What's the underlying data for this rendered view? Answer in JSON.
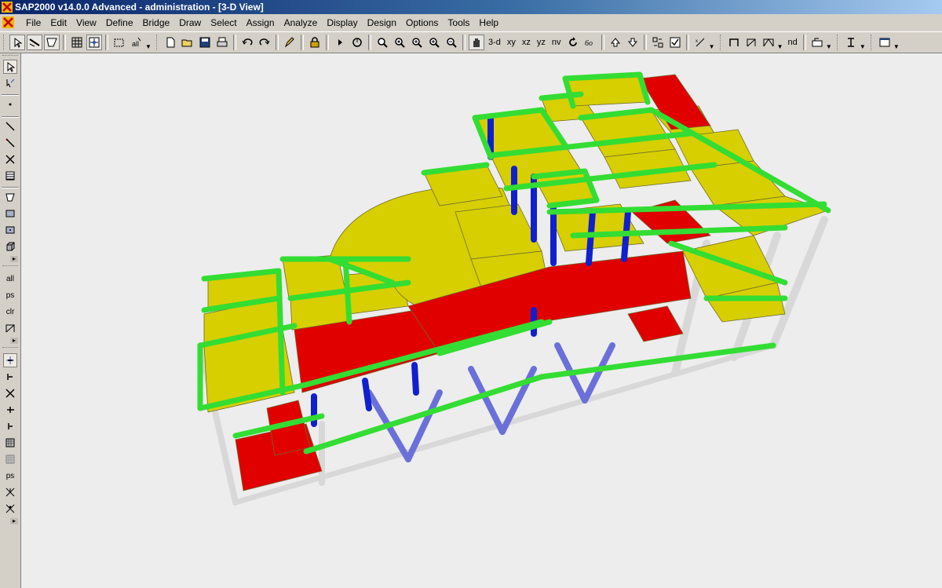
{
  "window": {
    "title": "SAP2000 v14.0.0 Advanced  - administration - [3-D View]"
  },
  "menu": [
    "File",
    "Edit",
    "View",
    "Define",
    "Bridge",
    "Draw",
    "Select",
    "Assign",
    "Analyze",
    "Display",
    "Design",
    "Options",
    "Tools",
    "Help"
  ],
  "toolbar": {
    "view_3d": "3-d",
    "view_xy": "xy",
    "view_xz": "xz",
    "view_yz": "yz",
    "view_nv": "nv",
    "nd": "nd"
  },
  "left_toolbar": {
    "select_all": "all",
    "get_previous": "ps",
    "clear_selection": "clr",
    "snap_ps": "ps"
  },
  "colors": {
    "beam": "#33dd33",
    "slab": "#d7cf00",
    "selected_slab": "#e00000",
    "column": "#1020cc",
    "brace": "#6a70d8",
    "grey_frame": "#d8d8d8",
    "background": "#ededed"
  }
}
